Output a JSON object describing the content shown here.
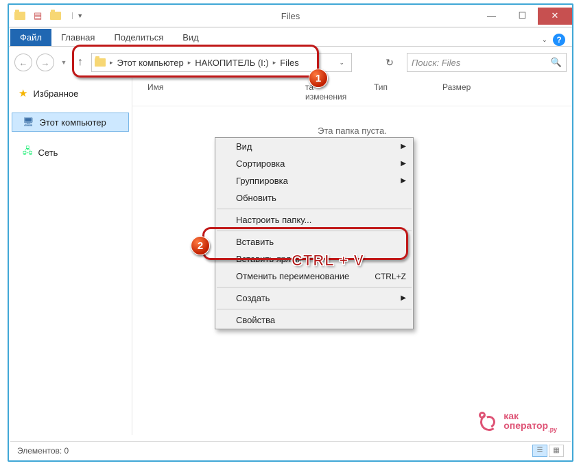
{
  "window": {
    "title": "Files"
  },
  "ribbon": {
    "file": "Файл",
    "tabs": [
      "Главная",
      "Поделиться",
      "Вид"
    ]
  },
  "breadcrumbs": [
    "Этот компьютер",
    "НАКОПИТЕЛЬ (I:)",
    "Files"
  ],
  "search": {
    "placeholder": "Поиск: Files"
  },
  "sidebar": {
    "favorites": "Избранное",
    "this_pc": "Этот компьютер",
    "network": "Сеть"
  },
  "columns": {
    "name": "Имя",
    "date": "та изменения",
    "type": "Тип",
    "size": "Размер"
  },
  "empty_message": "Эта папка пуста.",
  "context_menu": {
    "view": "Вид",
    "sort": "Сортировка",
    "group": "Группировка",
    "refresh": "Обновить",
    "customize": "Настроить папку...",
    "paste": "Вставить",
    "paste_shortcut": "Вставить ярлык",
    "undo_rename": "Отменить переименование",
    "undo_shortcut": "CTRL+Z",
    "create": "Создать",
    "properties": "Свойства"
  },
  "annotations": {
    "badge1": "1",
    "badge2": "2",
    "overlay": "CTRL + V"
  },
  "statusbar": {
    "items": "Элементов: 0"
  },
  "watermark": {
    "line1": "как",
    "line2": "оператор",
    "suffix": ".ру"
  }
}
